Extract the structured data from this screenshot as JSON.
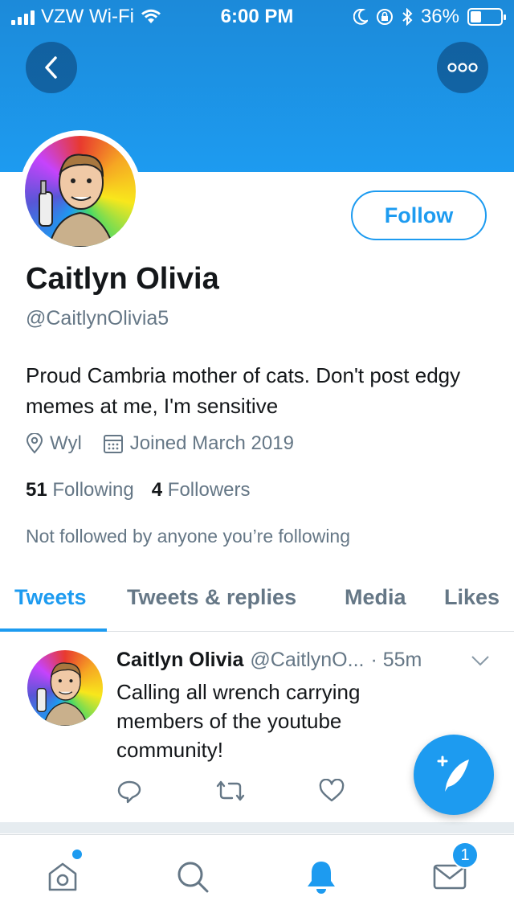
{
  "status_bar": {
    "carrier": "VZW Wi-Fi",
    "time": "6:00 PM",
    "battery_percent": "36%",
    "battery_level": 0.36,
    "icons": [
      "signal-icon",
      "wifi-icon",
      "moon-icon",
      "rotation-lock-icon",
      "bluetooth-icon",
      "battery-icon"
    ]
  },
  "header": {
    "back_icon": "back-arrow-icon",
    "more_icon": "more-options-icon",
    "colors": {
      "banner": "#1d9bf0",
      "accent": "#1d9bf0"
    }
  },
  "profile": {
    "name": "Caitlyn Olivia",
    "handle": "@CaitlynOlivia5",
    "follow_label": "Follow",
    "bio": "Proud Cambria mother of cats. Don't post edgy memes at me, I'm sensitive",
    "location": "Wyl",
    "joined": "Joined March 2019",
    "following_count": "51",
    "following_label": "Following",
    "followers_count": "4",
    "followers_label": "Followers",
    "not_followed": "Not followed by anyone you’re following"
  },
  "tabs": [
    {
      "label": "Tweets",
      "active": true
    },
    {
      "label": "Tweets & replies",
      "active": false
    },
    {
      "label": "Media",
      "active": false
    },
    {
      "label": "Likes",
      "active": false
    }
  ],
  "tweet": {
    "name": "Caitlyn Olivia",
    "handle": "@CaitlynO...",
    "time": "· 55m",
    "text": "Calling all wrench carrying members of the youtube community!",
    "actions": [
      "reply-icon",
      "retweet-icon",
      "like-icon"
    ]
  },
  "fab": {
    "icon": "compose-tweet-icon"
  },
  "bottom_nav": {
    "items": [
      "home-icon",
      "search-icon",
      "notifications-icon",
      "messages-icon"
    ],
    "messages_badge": "1"
  }
}
